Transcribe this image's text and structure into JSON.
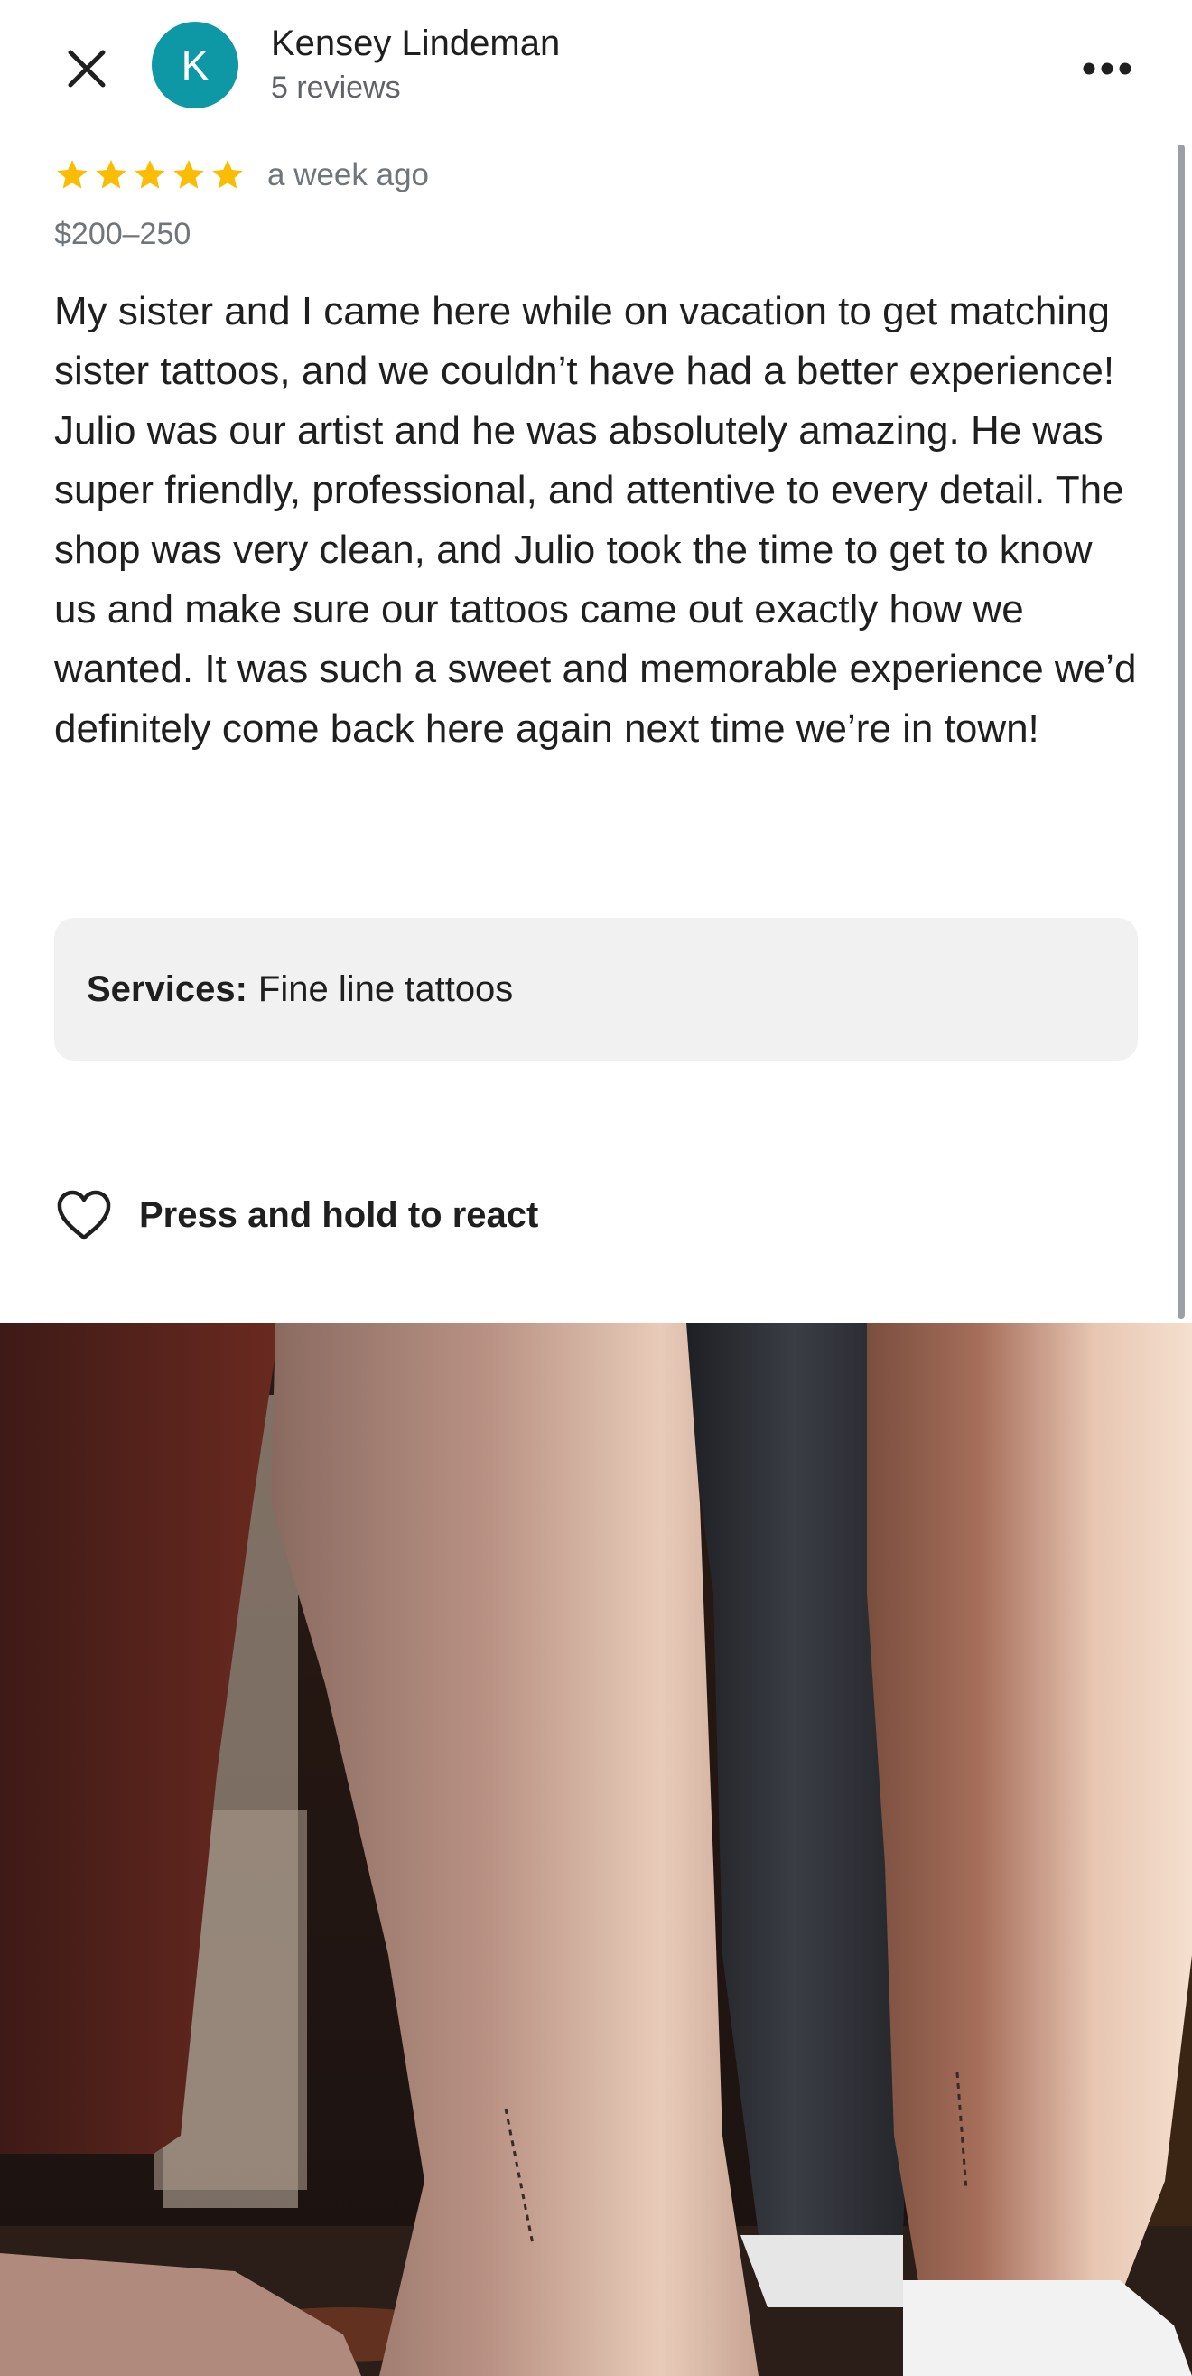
{
  "header": {
    "close_icon": "close-icon",
    "avatar_letter": "K",
    "avatar_color": "#0e98a6",
    "reviewer_name": "Kensey Lindeman",
    "reviewer_reviews": "5 reviews",
    "more_icon": "more-horizontal-icon"
  },
  "review": {
    "rating": 5,
    "max_rating": 5,
    "star_color": "#fbbc04",
    "time": "a week ago",
    "price": "$200–250",
    "text": "My sister and I came here while on vacation to get matching sister tattoos, and we couldn’t have had a better experience! Julio was our artist and he was absolutely amazing. He was super friendly, professional, and attentive to every detail. The shop was very clean, and Julio took the time to get to know us and make sure our tattoos came out exactly how we wanted. It was such a sweet and memorable experience we’d definitely come back here again next time we’re in town!",
    "services_label": "Services:",
    "services_value": "Fine line tattoos"
  },
  "reaction": {
    "icon": "heart-outline-icon",
    "label": "Press and hold to react"
  },
  "photo": {
    "subject": "two lower legs with matching fine line tattoos",
    "tattoo_text": "LINDEMAND"
  }
}
